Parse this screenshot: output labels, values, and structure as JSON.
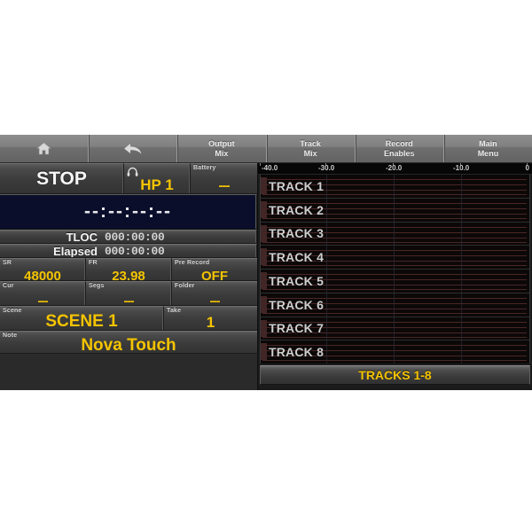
{
  "toolbar": {
    "buttons": [
      {
        "name": "home",
        "icon": "home-icon",
        "label": ""
      },
      {
        "name": "back",
        "icon": "back-arrow-icon",
        "label": ""
      },
      {
        "name": "output-mix",
        "icon": "",
        "label": "Output\nMix"
      },
      {
        "name": "track-mix",
        "icon": "",
        "label": "Track\nMix"
      },
      {
        "name": "record-enables",
        "icon": "",
        "label": "Record\nEnables"
      },
      {
        "name": "main-menu",
        "icon": "",
        "label": "Main\nMenu"
      }
    ]
  },
  "transport": {
    "status": "STOP",
    "hp_icon": "headphone-icon",
    "hp_value": "HP 1",
    "battery_label": "Battery",
    "battery_value": "---"
  },
  "timecode": {
    "value": "--:--:--:--"
  },
  "counters": {
    "tloc_label": "TLOC",
    "tloc_value": "000:00:00",
    "elapsed_label": "Elapsed",
    "elapsed_value": "000:00:00"
  },
  "audio": {
    "sr_label": "SR",
    "sr_value": "48000",
    "fr_label": "FR",
    "fr_value": "23.98",
    "prerecord_label": "Pre Record",
    "prerecord_value": "OFF"
  },
  "storage": {
    "cur_label": "Cur",
    "cur_value": "---",
    "segs_label": "Segs",
    "segs_value": "---",
    "folder_label": "Folder",
    "folder_value": "---"
  },
  "metadata": {
    "scene_label": "Scene",
    "scene_value": "SCENE 1",
    "take_label": "Take",
    "take_value": "1",
    "note_label": "Note",
    "note_value": "Nova Touch"
  },
  "meters": {
    "scale_ticks": [
      "-40.0",
      "-30.0",
      "-20.0",
      "-10.0",
      "0"
    ],
    "tracks": [
      {
        "label": "TRACK 1"
      },
      {
        "label": "TRACK 2"
      },
      {
        "label": "TRACK 3"
      },
      {
        "label": "TRACK 4"
      },
      {
        "label": "TRACK 5"
      },
      {
        "label": "TRACK 6"
      },
      {
        "label": "TRACK 7"
      },
      {
        "label": "TRACK 8"
      }
    ],
    "footer_label": "TRACKS 1-8"
  },
  "colors": {
    "accent_yellow": "#f5c400",
    "panel_bg": "#3b3b3b",
    "timecode_bg": "#0a0e2a",
    "meter_bg": "#0a0a0a"
  }
}
